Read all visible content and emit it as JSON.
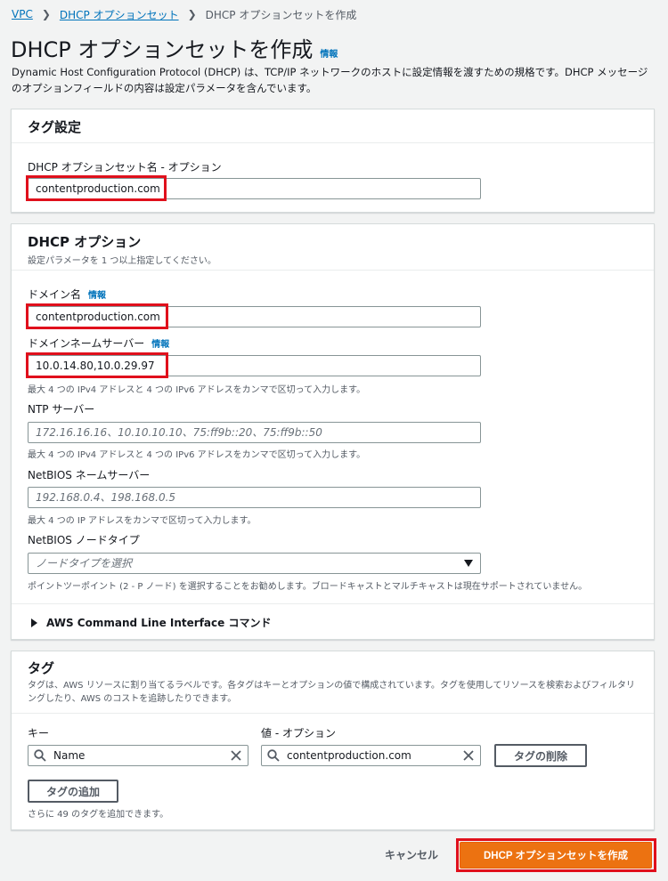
{
  "breadcrumb": {
    "vpc": "VPC",
    "dhcp_sets": "DHCP オプションセット",
    "current": "DHCP オプションセットを作成"
  },
  "page": {
    "title": "DHCP オプションセットを作成",
    "info": "情報",
    "description": "Dynamic Host Configuration Protocol (DHCP) は、TCP/IP ネットワークのホストに設定情報を渡すための規格です。DHCP メッセージのオプションフィールドの内容は設定パラメータを含んでいます。"
  },
  "tag_settings": {
    "title": "タグ設定",
    "name_label": "DHCP オプションセット名 - オプション",
    "name_value": "contentproduction.com"
  },
  "dhcp_options": {
    "title": "DHCP オプション",
    "subtitle": "設定パラメータを 1 つ以上指定してください。",
    "domain_name_label": "ドメイン名",
    "domain_name_info": "情報",
    "domain_name_value": "contentproduction.com",
    "dns_label": "ドメインネームサーバー",
    "dns_info": "情報",
    "dns_value": "10.0.14.80,10.0.29.97",
    "dns_help": "最大 4 つの IPv4 アドレスと 4 つの IPv6 アドレスをカンマで区切って入力します。",
    "ntp_label": "NTP サーバー",
    "ntp_placeholder": "172.16.16.16、10.10.10.10、75:ff9b::20、75:ff9b::50",
    "ntp_help": "最大 4 つの IPv4 アドレスと 4 つの IPv6 アドレスをカンマで区切って入力します。",
    "netbios_ns_label": "NetBIOS ネームサーバー",
    "netbios_ns_placeholder": "192.168.0.4、198.168.0.5",
    "netbios_ns_help": "最大 4 つの IP アドレスをカンマで区切って入力します。",
    "netbios_nt_label": "NetBIOS ノードタイプ",
    "netbios_nt_placeholder": "ノードタイプを選択",
    "netbios_nt_help": "ポイントツーポイント (2 - P ノード) を選択することをお勧めします。ブロードキャストとマルチキャストは現在サポートされていません。",
    "cli_expander": "AWS Command Line Interface コマンド"
  },
  "tags": {
    "title": "タグ",
    "description": "タグは、AWS リソースに割り当てるラベルです。各タグはキーとオプションの値で構成されています。タグを使用してリソースを検索およびフィルタリングしたり、AWS のコストを追跡したりできます。",
    "key_label": "キー",
    "value_label": "値 - オプション",
    "key_value": "Name",
    "value_value": "contentproduction.com",
    "remove_button": "タグの削除",
    "add_button": "タグの追加",
    "remaining": "さらに 49 のタグを追加できます。"
  },
  "footer": {
    "cancel": "キャンセル",
    "create": "DHCP オプションセットを作成"
  },
  "colors": {
    "primary": "#ec7211",
    "link": "#0073bb",
    "highlight": "#e0101c"
  }
}
